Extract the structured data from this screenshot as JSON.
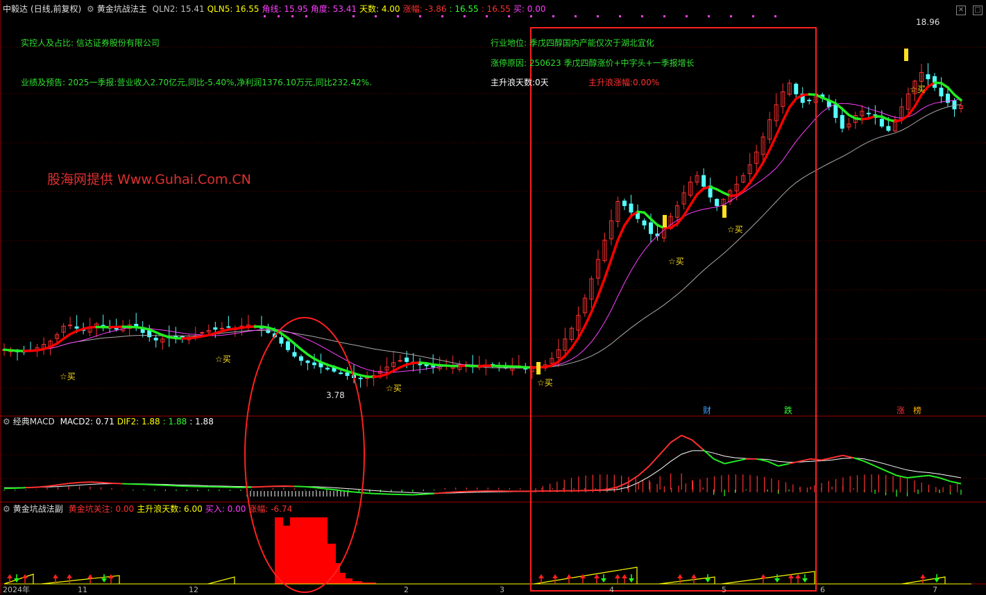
{
  "main": {
    "title": "中毅达",
    "period": "(日线,前复权)",
    "indicator": "黄金坑战法主",
    "readouts": [
      {
        "label": "QLN2:",
        "value": "15.41",
        "color": "#c0c0c0"
      },
      {
        "label": "QLN5:",
        "value": "16.55",
        "color": "#ffff00"
      },
      {
        "label": "角线:",
        "value": "15.95",
        "color": "#ff40ff"
      },
      {
        "label": "角度:",
        "value": "53.41",
        "color": "#ff40ff"
      },
      {
        "label": "天数:",
        "value": "4.00",
        "color": "#ffff00"
      },
      {
        "label": "涨幅:",
        "value": "-3.86",
        "color": "#ff3030"
      },
      {
        "label": ":",
        "value": "16.55",
        "color": "#30ff30"
      },
      {
        "label": ":",
        "value": "16.55",
        "color": "#ff3030"
      },
      {
        "label": "买:",
        "value": "0.00",
        "color": "#ff40ff"
      }
    ],
    "info_lines": {
      "controller": "实控人及占比: 信达证券股份有限公司",
      "forecast": "业绩及预告: 2025一季报:营业收入2.70亿元,同比-5.40%,净利润1376.10万元,同比232.42%.",
      "industry": "行业地位: 季戊四醇国内产能仅次于湖北宜化",
      "limitup": "涨停原因: 250623 季戊四醇涨价+中字头+一季报增长",
      "wave_days": "主升浪天数:0天",
      "wave_pct": "主升浪涨幅:0.00%"
    },
    "watermark": "股海网提供 Www.Guhai.Com.CN",
    "high_label": "18.96",
    "low_label": "3.78",
    "buy_label": "☆买",
    "tags": [
      {
        "text": "财",
        "color": "#3da0ff"
      },
      {
        "text": "跌",
        "color": "#30ff30"
      },
      {
        "text": "涨",
        "color": "#ff3030"
      },
      {
        "text": "榜",
        "color": "#ffb000"
      }
    ]
  },
  "macd": {
    "title": "经典MACD",
    "readouts": [
      {
        "label": "MACD2:",
        "value": "0.71",
        "color": "#ffffff"
      },
      {
        "label": "DIF2:",
        "value": "1.88",
        "color": "#ffff00"
      },
      {
        "label": ":",
        "value": "1.88",
        "color": "#30ff30"
      },
      {
        "label": ":",
        "value": "1.88",
        "color": "#ffffff"
      }
    ]
  },
  "sub": {
    "title": "黄金坑战法副",
    "readouts": [
      {
        "label": "黄金坑关注:",
        "value": "0.00",
        "color": "#ff3030"
      },
      {
        "label": "主升浪天数:",
        "value": "6.00",
        "color": "#ffff00"
      },
      {
        "label": "买入:",
        "value": "0.00",
        "color": "#ff40ff"
      },
      {
        "label": "涨幅:",
        "value": "-6.74",
        "color": "#ff3030"
      }
    ]
  },
  "axis_dates": [
    "2024年",
    "11",
    "12",
    "2",
    "3",
    "4",
    "5",
    "6",
    "7"
  ],
  "colors": {
    "up": "#ff3030",
    "down": "#54ffff",
    "ma_red": "#ff0000",
    "ma_green": "#22ee22",
    "ma_magenta": "#ff40ff",
    "ma_gray": "#aaaaaa",
    "grid": "#7a0000",
    "highlight": "#ff2020"
  },
  "chart_data": {
    "type": "candlestick",
    "price_range": [
      2.5,
      20.5
    ],
    "high": 18.96,
    "low": 3.78,
    "closes": [
      5.2,
      5.15,
      5.1,
      5.12,
      5.18,
      5.3,
      5.45,
      5.6,
      5.9,
      6.3,
      6.35,
      6.2,
      6.1,
      6.25,
      6.4,
      6.3,
      6.2,
      6.15,
      6.3,
      6.35,
      6.25,
      6.0,
      5.8,
      5.65,
      5.7,
      5.75,
      5.8,
      5.7,
      5.75,
      5.85,
      6.0,
      6.1,
      6.15,
      6.2,
      6.25,
      6.2,
      6.3,
      6.35,
      6.3,
      6.2,
      6.0,
      5.8,
      5.5,
      5.2,
      4.9,
      4.7,
      4.6,
      4.5,
      4.4,
      4.3,
      4.2,
      4.1,
      4.0,
      3.9,
      3.85,
      3.9,
      4.0,
      4.2,
      4.4,
      4.6,
      4.7,
      4.65,
      4.55,
      4.5,
      4.45,
      4.4,
      4.5,
      4.45,
      4.4,
      4.45,
      4.5,
      4.4,
      4.45,
      4.5,
      4.45,
      4.4,
      4.35,
      4.4,
      4.45,
      4.3,
      4.35,
      4.4,
      4.5,
      4.8,
      5.2,
      5.7,
      6.2,
      6.8,
      7.6,
      8.5,
      9.4,
      10.3,
      11.2,
      12.1,
      11.9,
      11.6,
      11.3,
      11.0,
      10.6,
      10.5,
      10.9,
      11.4,
      11.9,
      12.5,
      13.0,
      13.3,
      12.8,
      12.3,
      11.9,
      12.2,
      12.6,
      12.9,
      13.3,
      13.8,
      14.4,
      15.1,
      15.9,
      16.6,
      17.2,
      17.6,
      17.1,
      16.7,
      16.8,
      17.1,
      16.9,
      16.5,
      16.0,
      15.5,
      15.7,
      16.1,
      16.3,
      16.2,
      16.0,
      15.6,
      15.4,
      15.9,
      16.5,
      17.1,
      17.7,
      18.1,
      17.8,
      17.4,
      17.0,
      16.7,
      16.4,
      16.55
    ],
    "macd_dif": [
      0.05,
      0.06,
      0.08,
      0.1,
      0.14,
      0.2,
      0.26,
      0.3,
      0.32,
      0.3,
      0.27,
      0.25,
      0.23,
      0.22,
      0.2,
      0.18,
      0.16,
      0.14,
      0.13,
      0.12,
      0.11,
      0.1,
      0.09,
      0.1,
      0.12,
      0.14,
      0.15,
      0.14,
      0.12,
      0.08,
      0.03,
      -0.02,
      -0.08,
      -0.12,
      -0.16,
      -0.18,
      -0.2,
      -0.21,
      -0.22,
      -0.2,
      -0.17,
      -0.13,
      -0.1,
      -0.08,
      -0.07,
      -0.06,
      -0.06,
      -0.07,
      -0.07,
      -0.07,
      -0.06,
      -0.06,
      -0.05,
      -0.05,
      -0.04,
      -0.03,
      0.0,
      0.1,
      0.3,
      0.6,
      1.0,
      1.5,
      2.0,
      2.3,
      2.1,
      1.7,
      1.3,
      1.1,
      1.2,
      1.3,
      1.3,
      1.2,
      1.0,
      1.1,
      1.2,
      1.3,
      1.25,
      1.35,
      1.45,
      1.35,
      1.2,
      1.0,
      0.8,
      0.6,
      0.5,
      0.55,
      0.6,
      0.5,
      0.35,
      0.25
    ],
    "macd_dea": [
      0.08,
      0.08,
      0.09,
      0.1,
      0.11,
      0.13,
      0.16,
      0.19,
      0.22,
      0.24,
      0.25,
      0.25,
      0.25,
      0.24,
      0.23,
      0.22,
      0.2,
      0.19,
      0.18,
      0.16,
      0.15,
      0.14,
      0.13,
      0.12,
      0.12,
      0.13,
      0.13,
      0.13,
      0.13,
      0.12,
      0.1,
      0.07,
      0.04,
      0.01,
      -0.03,
      -0.06,
      -0.09,
      -0.11,
      -0.13,
      -0.15,
      -0.15,
      -0.15,
      -0.14,
      -0.12,
      -0.11,
      -0.1,
      -0.09,
      -0.09,
      -0.08,
      -0.08,
      -0.07,
      -0.07,
      -0.06,
      -0.06,
      -0.05,
      -0.04,
      -0.03,
      0.0,
      0.1,
      0.3,
      0.55,
      0.85,
      1.2,
      1.5,
      1.65,
      1.65,
      1.55,
      1.42,
      1.35,
      1.32,
      1.3,
      1.28,
      1.2,
      1.16,
      1.17,
      1.2,
      1.22,
      1.26,
      1.32,
      1.34,
      1.3,
      1.2,
      1.08,
      0.95,
      0.83,
      0.76,
      0.72,
      0.66,
      0.58,
      0.5
    ]
  }
}
